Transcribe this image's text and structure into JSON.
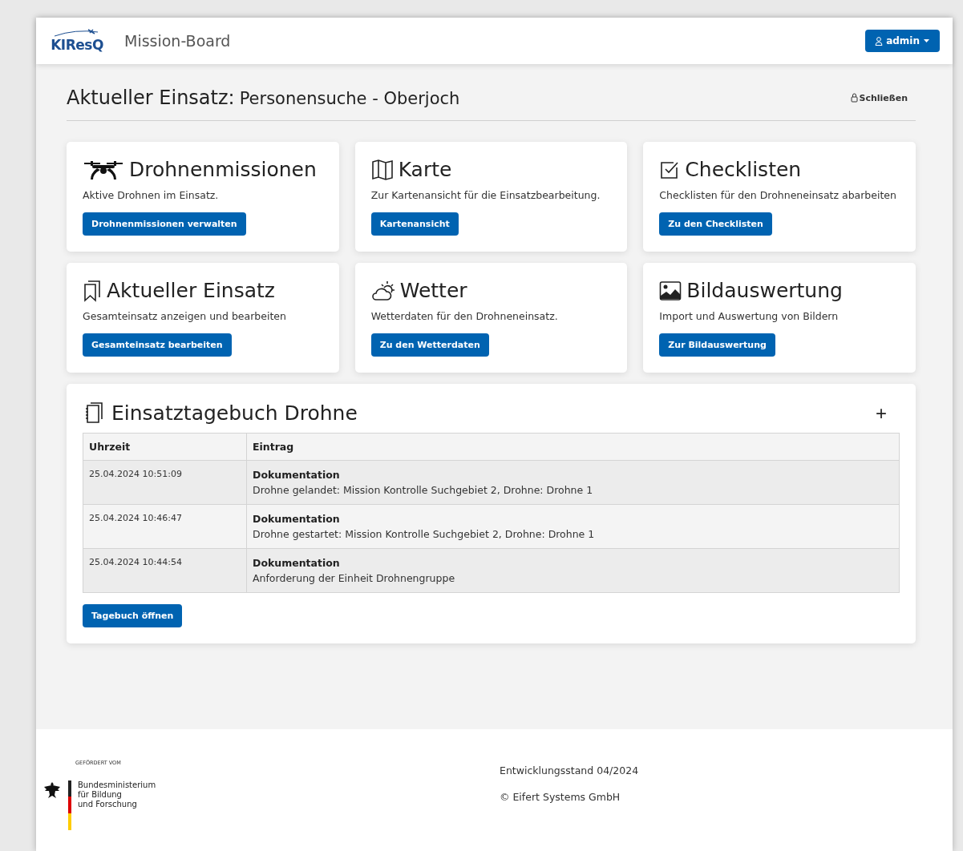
{
  "navbar": {
    "logo": "KIResQ",
    "title": "Mission-Board",
    "user_button": "admin"
  },
  "heading": {
    "label": "Aktueller Einsatz:",
    "mission": "Personensuche - Oberjoch",
    "close_link": "Schließen"
  },
  "cards": [
    {
      "title": "Drohnenmissionen",
      "text": "Aktive Drohnen im Einsatz.",
      "button": "Drohnenmissionen verwalten"
    },
    {
      "title": "Karte",
      "text": "Zur Kartenansicht für die Einsatzbearbeitung.",
      "button": "Kartenansicht"
    },
    {
      "title": "Checklisten",
      "text": "Checklisten für den Drohneneinsatz abarbeiten",
      "button": "Zu den Checklisten"
    },
    {
      "title": "Aktueller Einsatz",
      "text": "Gesamteinsatz anzeigen und bearbeiten",
      "button": "Gesamteinsatz bearbeiten"
    },
    {
      "title": "Wetter",
      "text": "Wetterdaten für den Drohneneinsatz.",
      "button": "Zu den Wetterdaten"
    },
    {
      "title": "Bildauswertung",
      "text": "Import und Auswertung von Bildern",
      "button": "Zur Bildauswertung"
    }
  ],
  "journal": {
    "title": "Einsatztagebuch Drohne",
    "add_button": "+",
    "columns": [
      "Uhrzeit",
      "Eintrag"
    ],
    "rows": [
      {
        "time": "25.04.2024 10:51:09",
        "type": "Dokumentation",
        "text": "Drohne gelandet: Mission Kontrolle Suchgebiet 2, Drohne: Drohne 1"
      },
      {
        "time": "25.04.2024 10:46:47",
        "type": "Dokumentation",
        "text": "Drohne gestartet: Mission Kontrolle Suchgebiet 2, Drohne: Drohne 1"
      },
      {
        "time": "25.04.2024 10:44:54",
        "type": "Dokumentation",
        "text": "Anforderung der Einheit Drohnengruppe"
      }
    ],
    "open_button": "Tagebuch öffnen"
  },
  "footer": {
    "funded_by": "GEFÖRDERT VOM",
    "ministry": [
      "Bundesministerium",
      "für Bildung",
      "und Forschung"
    ],
    "version": "Entwicklungsstand 04/2024",
    "copyright": "© Eifert Systems GmbH"
  }
}
